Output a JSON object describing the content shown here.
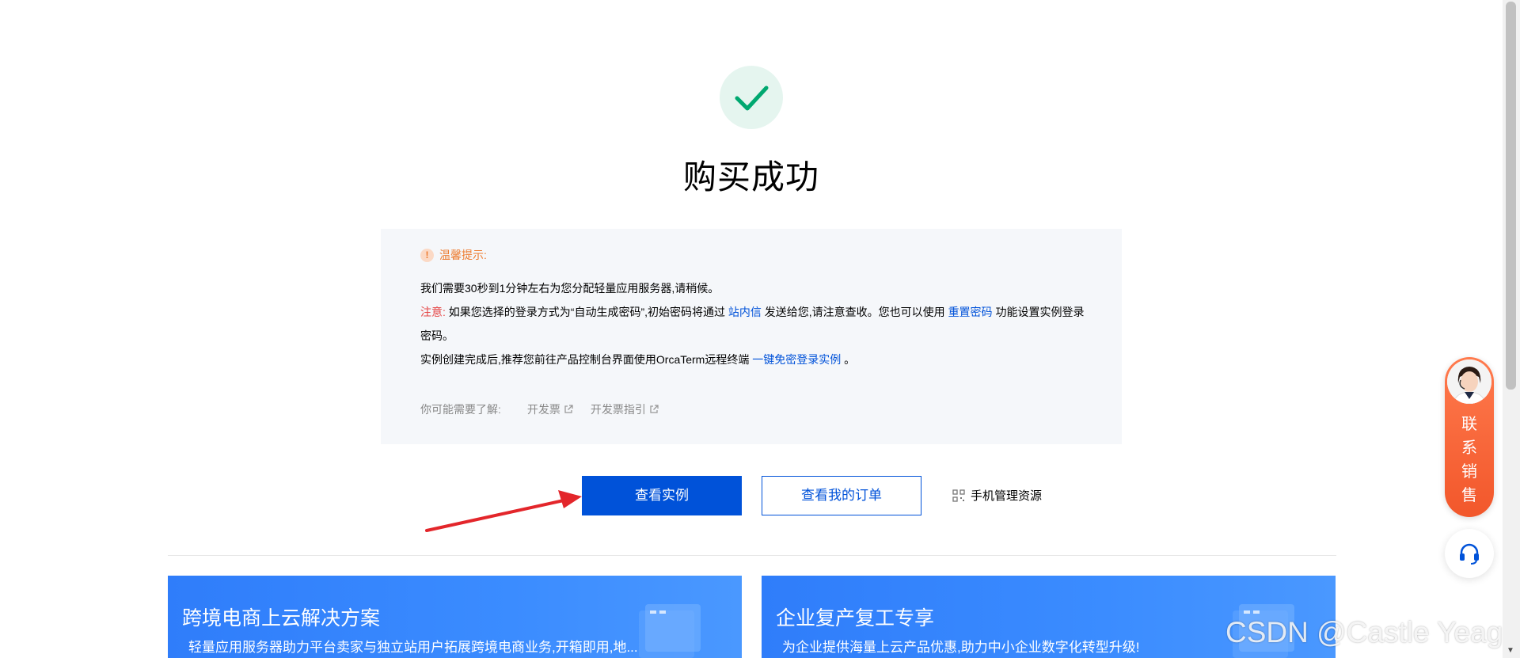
{
  "page": {
    "title": "购买成功"
  },
  "notice": {
    "title": "温馨提示:",
    "line1": "我们需要30秒到1分钟左右为您分配轻量应用服务器,请稍候。",
    "line2_prefix": "注意:",
    "line2_text_a": " 如果您选择的登录方式为“自动生成密码”,初始密码将通过 ",
    "line2_link1": "站内信",
    "line2_text_b": " 发送给您,请注意查收。您也可以使用 ",
    "line2_link2": "重置密码",
    "line2_text_c": " 功能设置实例登录密码。",
    "line3_text": "实例创建完成后,推荐您前往产品控制台界面使用OrcaTerm远程终端 ",
    "line3_link": "一键免密登录实例",
    "line3_end": " 。",
    "learn_label": "你可能需要了解:",
    "learn_links": [
      "开发票",
      "开发票指引"
    ]
  },
  "actions": {
    "view_instance": "查看实例",
    "view_orders": "查看我的订单",
    "mobile_manage": "手机管理资源"
  },
  "banners": [
    {
      "title": "跨境电商上云解决方案",
      "desc": "轻量应用服务器助力平台卖家与独立站用户拓展跨境电商业务,开箱即用,地..."
    },
    {
      "title": "企业复产复工专享",
      "desc": "为企业提供海量上云产品优惠,助力中小企业数字化转型升级!"
    }
  ],
  "sales_widget": {
    "label": "联系销售"
  },
  "watermark": "CSDN @Castle Yeager",
  "colors": {
    "primary": "#0052d9",
    "success": "#00a870",
    "warning": "#ed7b2f",
    "danger": "#e54545",
    "arrow": "#e3262b"
  }
}
